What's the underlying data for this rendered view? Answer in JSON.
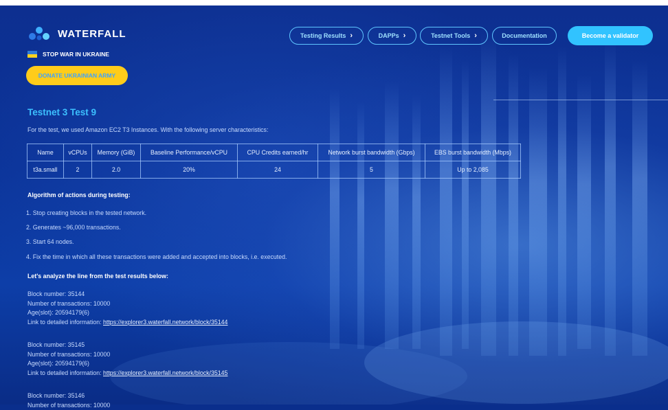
{
  "header": {
    "logo_text": "WATERFALL",
    "ukraine_text": "STOP WAR IN UKRAINE",
    "donate_label": "DONATE UKRAINIAN ARMY",
    "nav": [
      {
        "label": "Testing Results",
        "icon": "chevron-right-icon"
      },
      {
        "label": "DAPPs",
        "icon": "chevron-right-icon"
      },
      {
        "label": "Testnet Tools",
        "icon": "chevron-right-icon"
      },
      {
        "label": "Documentation",
        "icon": ""
      }
    ],
    "validator_label": "Become a validator"
  },
  "main": {
    "title": "Testnet 3 Test 9",
    "intro": "For the test, we used Amazon EC2 T3 Instances. With the following server characteristics:",
    "table": {
      "headers": [
        "Name",
        "vCPUs",
        "Memory (GiB)",
        "Baseline Performance/vCPU",
        "CPU Credits earned/hr",
        "Network burst bandwidth (Gbps)",
        "EBS burst bandwidth (Mbps)"
      ],
      "row": [
        "t3a.small",
        "2",
        "2.0",
        "20%",
        "24",
        "5",
        "Up to 2,085"
      ]
    },
    "algorithm_heading": "Algorithm of actions during testing:",
    "steps": [
      "1.  Stop creating blocks in the tested network.",
      "2.  Generates ~96,000 transactions.",
      "3.  Start 64 nodes.",
      "4.  Fix the time in which all these transactions were added and accepted into blocks, i.e. executed."
    ],
    "analyze_heading": "Let's analyze the line from the test results below:",
    "link_prefix": "Link to detailed information: ",
    "blocks": [
      {
        "block": "Block number: 35144",
        "tx": "Number of transactions: 10000",
        "age": "Age(slot): 20594179(6)",
        "link": "https://explorer3.waterfall.network/block/35144"
      },
      {
        "block": "Block number: 35145",
        "tx": "Number of transactions: 10000",
        "age": "Age(slot): 20594179(6)",
        "link": "https://explorer3.waterfall.network/block/35145"
      },
      {
        "block": "Block number: 35146",
        "tx": "Number of transactions: 10000"
      }
    ]
  },
  "colors": {
    "background": "#0a2e8c",
    "accent_cyan": "#31c3ff",
    "donate_yellow": "#ffcc1a"
  }
}
